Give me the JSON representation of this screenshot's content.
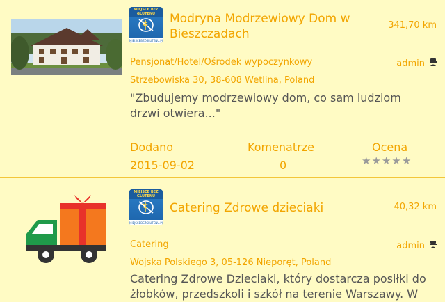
{
  "colors": {
    "accent": "#f2a500",
    "background": "#fffbc4",
    "divider": "#f3c63a",
    "text": "#555555",
    "star": "#9a9a9a"
  },
  "logo_text": {
    "top": "MIEJSCE BEZ GLUTENU",
    "bottom": "MIEJSCEBEZGLUTENU.PL"
  },
  "entries": [
    {
      "title_line1": "Modryna Modrzewiowy Dom w",
      "title_line2": "Bieszczadach",
      "distance": "341,70 km",
      "category": "Pensjonat/Hotel/Ośrodek wypoczynkowy",
      "author": "admin",
      "address": "Strzebowiska 30, 38-608 Wetlina, Poland",
      "desc_line1": "\"Zbudujemy modrzewiowy dom, co sam ludziom",
      "desc_line2": "drzwi otwiera...\"",
      "added_label": "Dodano",
      "added_value": "2015-09-02",
      "comments_label": "Komenatrze",
      "comments_value": "0",
      "rating_label": "Ocena",
      "rating_stars": [
        "★",
        "★",
        "★",
        "★",
        "★"
      ],
      "rating_value": 0
    },
    {
      "title_line1": "Catering Zdrowe dzieciaki",
      "distance": "40,32 km",
      "category": "Catering",
      "author": "admin",
      "address": "Wojska Polskiego 3, 05-126 Nieporęt, Poland",
      "desc_line1": "Catering Zdrowe Dzieciaki, który dostarcza posiłki do",
      "desc_line2": "żłobków, przedszkoli i szkół na terenie Warszawy. W"
    }
  ]
}
